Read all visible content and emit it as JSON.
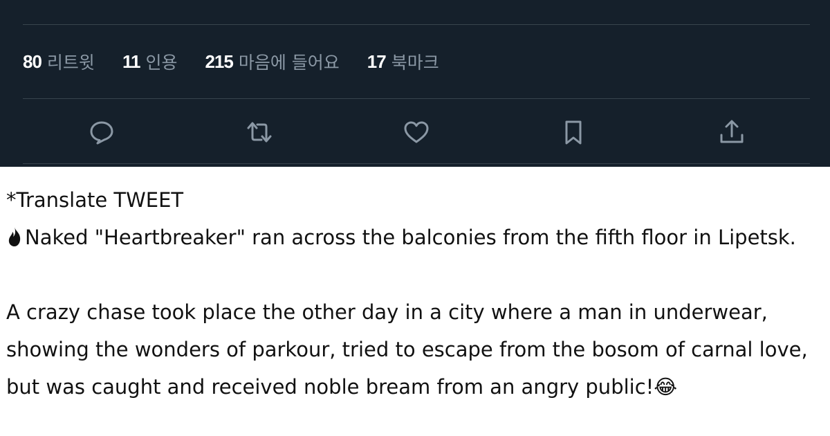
{
  "stats": [
    {
      "count": "80",
      "label": "리트윗"
    },
    {
      "count": "11",
      "label": "인용"
    },
    {
      "count": "215",
      "label": "마음에 들어요"
    },
    {
      "count": "17",
      "label": "북마크"
    }
  ],
  "actions": [
    {
      "icon": "reply-icon"
    },
    {
      "icon": "retweet-icon"
    },
    {
      "icon": "like-icon"
    },
    {
      "icon": "bookmark-icon"
    },
    {
      "icon": "share-icon"
    }
  ],
  "translation": {
    "header": "*Translate TWEET",
    "headline_icon": "fire-emoji",
    "headline": "Naked \"Heartbreaker\" ran across the balconies from the fifth floor in Lipetsk.",
    "body": "A crazy chase took place the other day in a city where a man in underwear, showing the wonders of parkour, tried to escape from the bosom of carnal love, but was caught and received noble bream from an angry public!😂"
  },
  "colors": {
    "panel_bg": "#15202b",
    "divider": "#38444d",
    "count_text": "#ffffff",
    "label_text": "#8b98a5",
    "icon": "#8b98a5"
  }
}
